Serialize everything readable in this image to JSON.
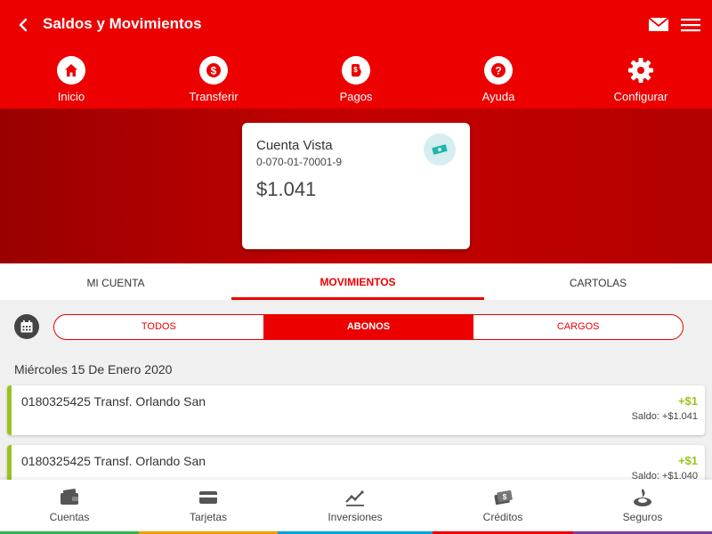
{
  "header": {
    "title": "Saldos y Movimientos",
    "back_icon": "chevron-left-icon",
    "mail_icon": "mail-icon",
    "menu_icon": "hamburger-menu-icon"
  },
  "quick_actions": [
    {
      "label": "Inicio",
      "icon": "home-icon"
    },
    {
      "label": "Transferir",
      "icon": "dollar-icon"
    },
    {
      "label": "Pagos",
      "icon": "payment-icon"
    },
    {
      "label": "Ayuda",
      "icon": "question-icon"
    },
    {
      "label": "Configurar",
      "icon": "gear-icon"
    }
  ],
  "account_card": {
    "title": "Cuenta Vista",
    "number": "0-070-01-70001-9",
    "balance": "$1.041",
    "icon": "banknote-icon"
  },
  "tabs": [
    {
      "label": "MI CUENTA",
      "active": false
    },
    {
      "label": "MOVIMIENTOS",
      "active": true
    },
    {
      "label": "CARTOLAS",
      "active": false
    }
  ],
  "filter": {
    "calendar_icon": "calendar-icon",
    "options": [
      {
        "label": "TODOS",
        "active": false
      },
      {
        "label": "ABONOS",
        "active": true
      },
      {
        "label": "CARGOS",
        "active": false
      }
    ]
  },
  "date_header": "Miércoles 15 De Enero 2020",
  "movements": [
    {
      "description": "0180325425 Transf. Orlando San",
      "amount": "+$1",
      "balance": "Saldo: +$1.041"
    },
    {
      "description": "0180325425 Transf. Orlando San",
      "amount": "+$1",
      "balance": "Saldo: +$1.040"
    }
  ],
  "bottom_nav": [
    {
      "label": "Cuentas",
      "icon": "wallet-icon",
      "color": "#2db84d"
    },
    {
      "label": "Tarjetas",
      "icon": "credit-card-icon",
      "color": "#f59b00"
    },
    {
      "label": "Inversiones",
      "icon": "chart-line-icon",
      "color": "#00a3e0"
    },
    {
      "label": "Créditos",
      "icon": "money-icon",
      "color": "#ec0000"
    },
    {
      "label": "Seguros",
      "icon": "santander-flame-icon",
      "color": "#7a3fa0"
    }
  ],
  "colors": {
    "primary": "#ec0000",
    "credit_green": "#9bc31f",
    "card_icon_bg": "#d6eef0"
  }
}
